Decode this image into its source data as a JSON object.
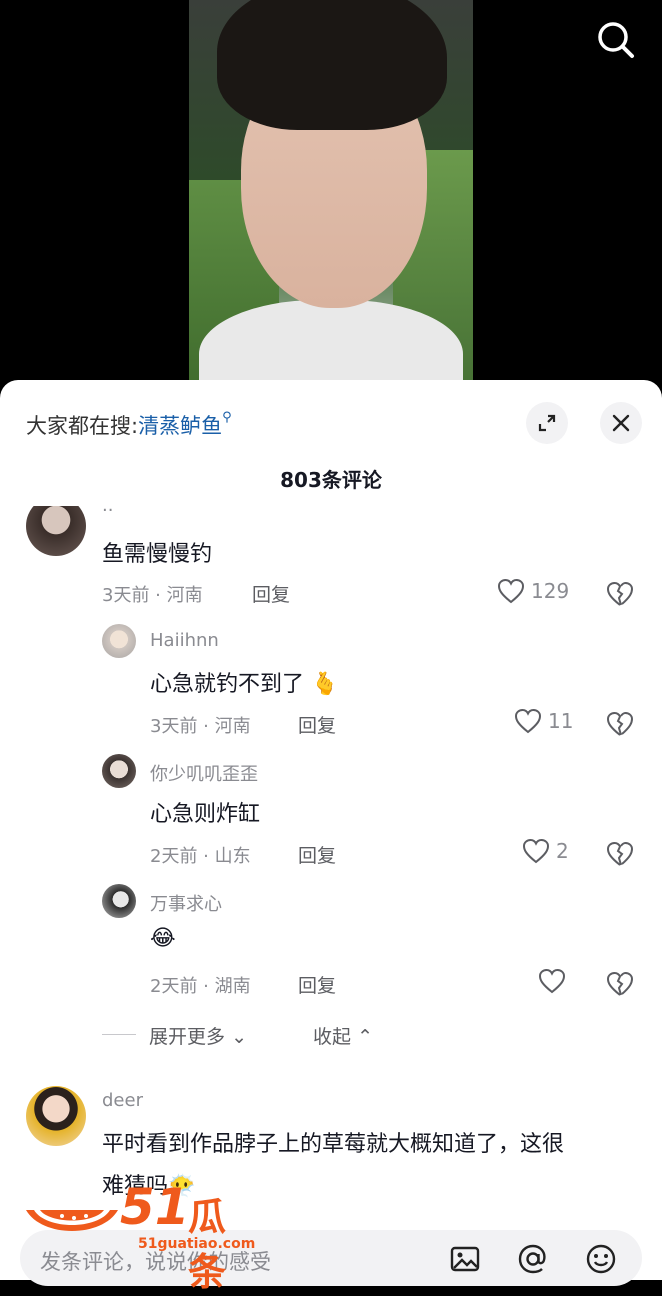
{
  "video": {
    "description_icon": "person-video-frame"
  },
  "header": {
    "hot_search_prefix": "大家都在搜:",
    "hot_search_keyword": "清蒸鲈鱼",
    "comments_count_title": "803条评论"
  },
  "comments": [
    {
      "username": "··",
      "text": "鱼需慢慢钓",
      "meta": "3天前 · 河南",
      "reply_label": "回复",
      "likes": "129"
    },
    {
      "username": "Haiihnn",
      "text": "心急就钓不到了",
      "emoji": "🫰",
      "meta": "3天前 · 河南",
      "reply_label": "回复",
      "likes": "11"
    },
    {
      "username": "你少叽叽歪歪",
      "text": "心急则炸缸",
      "meta": "2天前 · 山东",
      "reply_label": "回复",
      "likes": "2"
    },
    {
      "username": "万事求心",
      "text": "😂",
      "meta": "2天前 · 湖南",
      "reply_label": "回复",
      "likes": ""
    },
    {
      "username": "deer",
      "text_line1": "平时看到作品脖子上的草莓就大概知道了，这很",
      "text_line2": "难猜吗",
      "emoji": "😶‍🌫️"
    }
  ],
  "replies_controls": {
    "expand_more": "展开更多",
    "collapse": "收起"
  },
  "input": {
    "placeholder": "发条评论，说说你的感受"
  },
  "watermark": {
    "brand_cn": "瓜条",
    "brand_num": "51",
    "url": "51guatiao.com"
  },
  "colors": {
    "accent_link": "#1a5fa8",
    "watermark": "#ef5a1c",
    "sheet_bg": "#ffffff"
  },
  "icons": [
    "search-icon",
    "expand-icon",
    "close-icon",
    "heart-icon",
    "broken-heart-icon",
    "image-icon",
    "at-icon",
    "emoji-icon"
  ]
}
